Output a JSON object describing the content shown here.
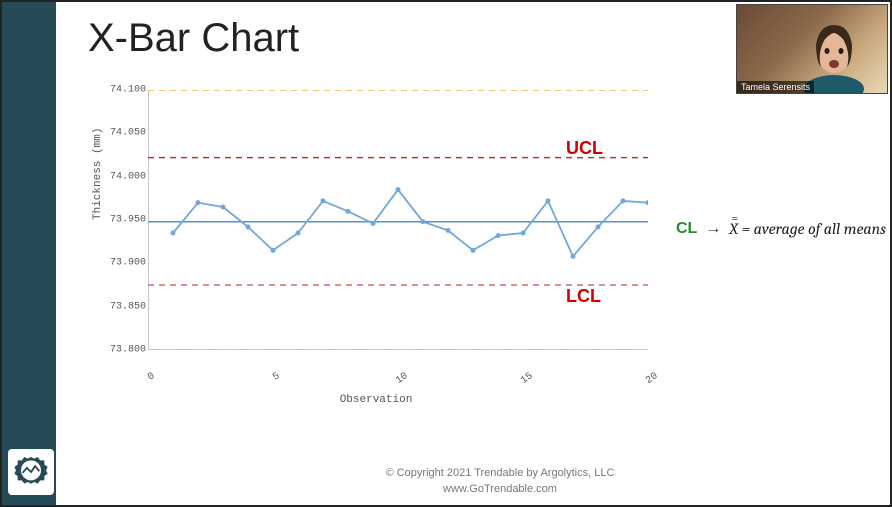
{
  "title": "X-Bar Chart",
  "webcam": {
    "name": "Tamela Serensits"
  },
  "annotations": {
    "cl": "CL",
    "arrow": "→",
    "formula_var": "X",
    "formula_rest": " = average of all means",
    "ucl": "UCL",
    "lcl": "LCL"
  },
  "footer": {
    "line1": "© Copyright 2021   Trendable by Argolytics, LLC",
    "line2": "www.GoTrendable.com"
  },
  "chart_data": {
    "type": "line",
    "title": "X-Bar Chart",
    "xlabel": "Observation",
    "ylabel": "Thickness (mm)",
    "ylim": [
      73.8,
      74.1
    ],
    "yticks": [
      73.8,
      73.85,
      73.9,
      73.95,
      74.0,
      74.05,
      74.1
    ],
    "xticks": [
      0,
      5,
      10,
      15,
      20
    ],
    "x": [
      1,
      2,
      3,
      4,
      5,
      6,
      7,
      8,
      9,
      10,
      11,
      12,
      13,
      14,
      15,
      16,
      17,
      18,
      19,
      20
    ],
    "values": [
      73.935,
      73.97,
      73.965,
      73.942,
      73.915,
      73.935,
      73.972,
      73.96,
      73.946,
      73.985,
      73.948,
      73.938,
      73.915,
      73.932,
      73.935,
      73.972,
      73.908,
      73.942,
      73.972,
      73.97
    ],
    "reference_lines": {
      "USL": 74.1,
      "UCL": 74.022,
      "CL": 73.948,
      "LCL": 73.875,
      "LSL": 73.8
    }
  }
}
